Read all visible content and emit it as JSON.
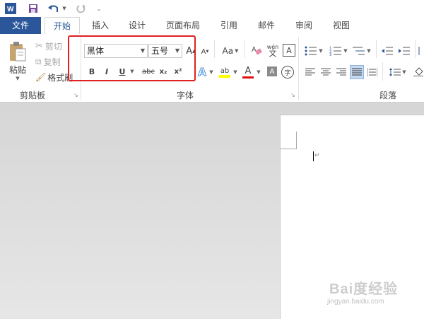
{
  "quick_access": {
    "app_icon": "word-icon",
    "save_icon": "save-icon",
    "undo_icon": "undo-icon",
    "redo_icon": "redo-icon",
    "customize_icon": "customize-icon"
  },
  "tabs": [
    {
      "label": "文件",
      "kind": "file"
    },
    {
      "label": "开始",
      "kind": "active"
    },
    {
      "label": "插入"
    },
    {
      "label": "设计"
    },
    {
      "label": "页面布局"
    },
    {
      "label": "引用"
    },
    {
      "label": "邮件"
    },
    {
      "label": "审阅"
    },
    {
      "label": "视图"
    }
  ],
  "clipboard": {
    "paste_label": "粘贴",
    "cut_label": "剪切",
    "copy_label": "复制",
    "format_painter_label": "格式刷",
    "group_label": "剪贴板"
  },
  "font": {
    "font_name": "黑体",
    "font_size": "五号",
    "group_label": "字体",
    "grow_label": "A",
    "shrink_label": "A",
    "case_label": "Aa",
    "phonetic_label": "wén",
    "phonetic_char": "文",
    "border_label": "A",
    "bold_label": "B",
    "italic_label": "I",
    "underline_label": "U",
    "strike_label": "abc",
    "subscript_label": "x₂",
    "superscript_label": "x²",
    "effects_label": "A",
    "highlight_label": "ab",
    "font_color_label": "A",
    "shading_label": "A",
    "enclose_label": "字"
  },
  "paragraph": {
    "group_label": "段落"
  },
  "colors": {
    "accent": "#2b579a",
    "highlight_box": "#e02020",
    "font_color_bar": "#e01010",
    "highlight_bar": "#ffff00"
  },
  "watermark": {
    "brand": "Bai度经验",
    "url": "jingyan.baidu.com"
  }
}
